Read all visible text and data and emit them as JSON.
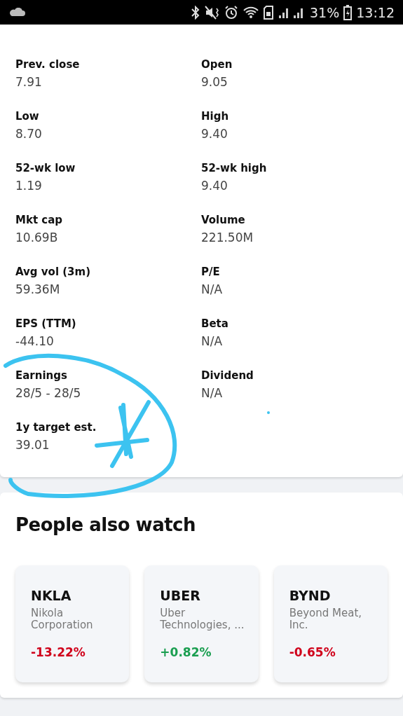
{
  "status_bar": {
    "battery": "31%",
    "time": "13:12"
  },
  "statistics": [
    {
      "label": "Prev. close",
      "value": "7.91"
    },
    {
      "label": "Open",
      "value": "9.05"
    },
    {
      "label": "Low",
      "value": "8.70"
    },
    {
      "label": "High",
      "value": "9.40"
    },
    {
      "label": "52-wk low",
      "value": "1.19"
    },
    {
      "label": "52-wk high",
      "value": "9.40"
    },
    {
      "label": "Mkt cap",
      "value": "10.69B"
    },
    {
      "label": "Volume",
      "value": "221.50M"
    },
    {
      "label": "Avg vol (3m)",
      "value": "59.36M"
    },
    {
      "label": "P/E",
      "value": "N/A"
    },
    {
      "label": "EPS (TTM)",
      "value": "-44.10"
    },
    {
      "label": "Beta",
      "value": "N/A"
    },
    {
      "label": "Earnings",
      "value": "28/5 - 28/5"
    },
    {
      "label": "Dividend",
      "value": "N/A"
    },
    {
      "label": "1y target est.",
      "value": "39.01"
    }
  ],
  "people_also_watch": {
    "title": "People also watch",
    "cards": [
      {
        "symbol": "NKLA",
        "name": "Nikola Corporation",
        "change": "-13.22%",
        "color": "#d0021b"
      },
      {
        "symbol": "UBER",
        "name": "Uber Technologies, ...",
        "change": "+0.82%",
        "color": "#1a9e50"
      },
      {
        "symbol": "BYND",
        "name": "Beyond Meat, Inc.",
        "change": "-0.65%",
        "color": "#d0021b"
      }
    ]
  }
}
